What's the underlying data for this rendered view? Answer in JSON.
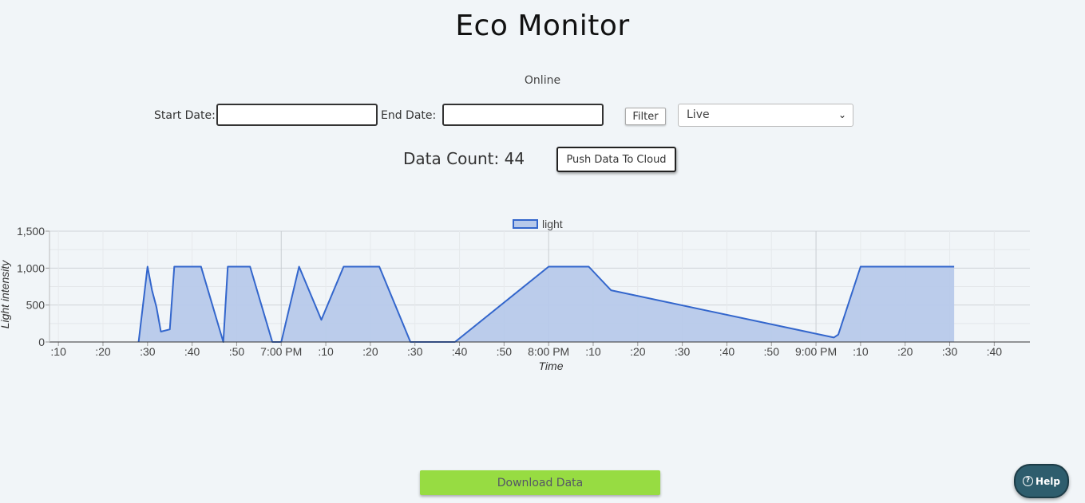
{
  "app": {
    "title": "Eco Monitor",
    "status": "Online"
  },
  "filters": {
    "start_label": "Start Date:",
    "start_value": "",
    "end_label": "End Date:",
    "end_value": "",
    "filter_label": "Filter",
    "mode_selected": "Live"
  },
  "data_count_text": "Data Count: 44",
  "push_label": "Push Data To Cloud",
  "download_label": "Download Data",
  "help": {
    "label": "Help",
    "icon": "question-circle-icon"
  },
  "colors": {
    "line": "#3366cc",
    "fill": "#b7c9ea",
    "download": "#97dc42",
    "help": "#2e5d6d"
  },
  "chart_data": {
    "type": "area",
    "xlabel": "Time",
    "ylabel": "Light intensity",
    "ylim": [
      0,
      1500
    ],
    "yticks": [
      0,
      500,
      1000,
      1500
    ],
    "ytick_labels": [
      "0",
      "500",
      "1,000",
      "1,500"
    ],
    "xlim": [
      "18:08",
      "21:48"
    ],
    "xtick_labels": [
      ":10",
      ":20",
      ":30",
      ":40",
      ":50",
      "7:00 PM",
      ":10",
      ":20",
      ":30",
      ":40",
      ":50",
      "8:00 PM",
      ":10",
      ":20",
      ":30",
      ":40",
      ":50",
      "9:00 PM",
      ":10",
      ":20",
      ":30",
      ":40"
    ],
    "legend": "top",
    "grid": true,
    "series": [
      {
        "name": "light",
        "x": [
          "18:28",
          "18:30",
          "18:31",
          "18:32",
          "18:33",
          "18:35",
          "18:36",
          "18:42",
          "18:47",
          "18:48",
          "18:53",
          "18:58",
          "19:00",
          "19:04",
          "19:09",
          "19:14",
          "19:22",
          "19:29",
          "19:39",
          "20:00",
          "20:09",
          "20:14",
          "21:04",
          "21:05",
          "21:10",
          "21:31"
        ],
        "values": [
          0,
          1020,
          700,
          470,
          140,
          170,
          1020,
          1020,
          0,
          1020,
          1020,
          0,
          0,
          1020,
          300,
          1020,
          1020,
          0,
          0,
          1020,
          1020,
          700,
          60,
          100,
          1020,
          1020
        ]
      }
    ]
  }
}
